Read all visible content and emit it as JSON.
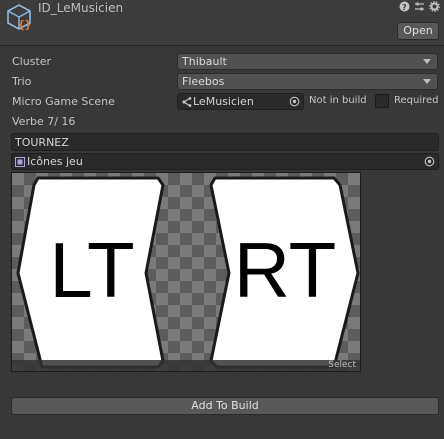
{
  "header": {
    "title": "ID_LeMusicien",
    "open_label": "Open",
    "icons": [
      "help-icon",
      "preset-icon",
      "settings-icon"
    ]
  },
  "fields": {
    "cluster": {
      "label": "Cluster",
      "value": "Thibault"
    },
    "trio": {
      "label": "Trio",
      "value": "Fleebos"
    },
    "scene": {
      "label": "Micro Game Scene",
      "value": "LeMusicien",
      "status": "Not in build",
      "required_label": "Required",
      "required_checked": false
    },
    "verbe": {
      "label": "Verbe 7/ 16",
      "value": "TOURNEZ"
    },
    "icons": {
      "value": "Icônes jeu"
    }
  },
  "preview": {
    "left_text": "LT",
    "right_text": "RT",
    "select_label": "Select"
  },
  "footer": {
    "build_label": "Add To Build"
  },
  "colors": {
    "background": "#383838",
    "field": "#2a2a2a",
    "button": "#585858",
    "text": "#c8c8c8"
  }
}
